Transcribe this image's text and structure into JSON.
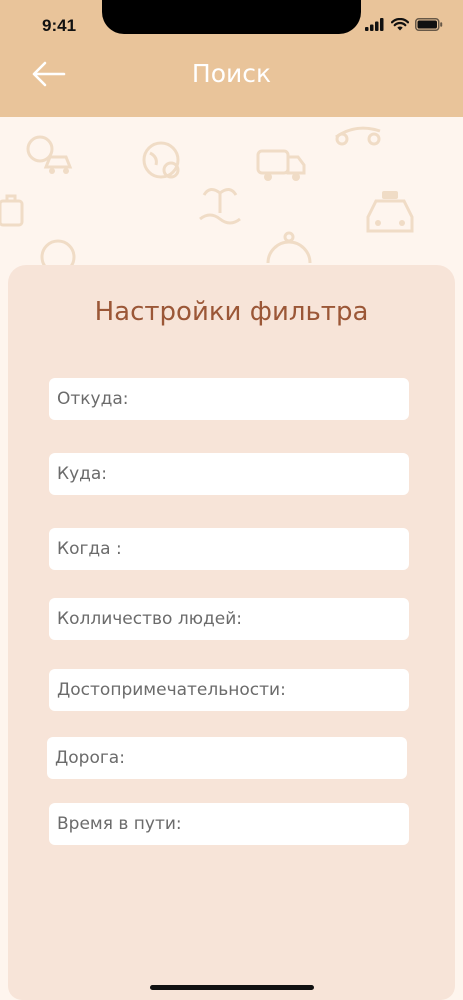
{
  "status_bar": {
    "time": "9:41"
  },
  "header": {
    "title": "Поиск",
    "back_icon": "arrow-left-icon"
  },
  "filter": {
    "title": "Настройки фильтра",
    "fields": [
      {
        "label": "Откуда:"
      },
      {
        "label": "Куда:"
      },
      {
        "label": "Когда :"
      },
      {
        "label": "Колличество людей:"
      },
      {
        "label": "Достопримечательности:"
      },
      {
        "label": "Дорога:"
      },
      {
        "label": "Время в пути:"
      }
    ]
  },
  "colors": {
    "header_bg": "#E9C49A",
    "page_bg": "#FEF5EE",
    "card_bg": "#F7E4D8",
    "title_color": "#9B5737",
    "field_text": "#6B6B6B"
  }
}
